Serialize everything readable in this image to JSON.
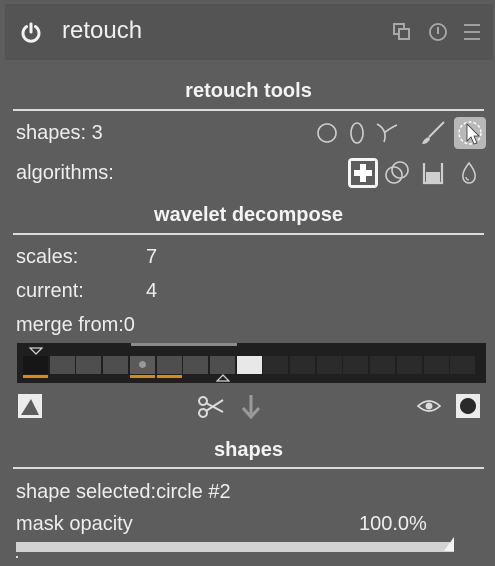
{
  "header": {
    "title": "retouch"
  },
  "sections": {
    "tools": "retouch tools",
    "wavelet": "wavelet decompose",
    "shapes": "shapes"
  },
  "tools": {
    "shapes_label": "shapes: 3",
    "algorithms_label": "algorithms:",
    "shape_icons": [
      "circle-icon",
      "ellipse-icon",
      "path-icon",
      "brush-icon",
      "pointer-icon"
    ],
    "algorithm_icons": [
      "heal-icon",
      "clone-icon",
      "fill-icon",
      "blur-icon"
    ]
  },
  "wavelet": {
    "scales_label": "scales:",
    "scales_value": "7",
    "current_label": "current:",
    "current_value": "4",
    "merge_label": "merge from:0",
    "strip": {
      "cells_total": 17,
      "scales": 7,
      "current": 4,
      "merge_from": 0
    }
  },
  "shapes": {
    "selected_label": "shape selected:circle #2",
    "opacity_label": "mask opacity",
    "opacity_value": "100.0%",
    "opacity_level": 1.0
  },
  "colors": {
    "panel_bg": "#5d5d5d",
    "header_bg": "#545454",
    "strip_bg": "#1f1f1f",
    "accent_orange": "#e08a00"
  }
}
